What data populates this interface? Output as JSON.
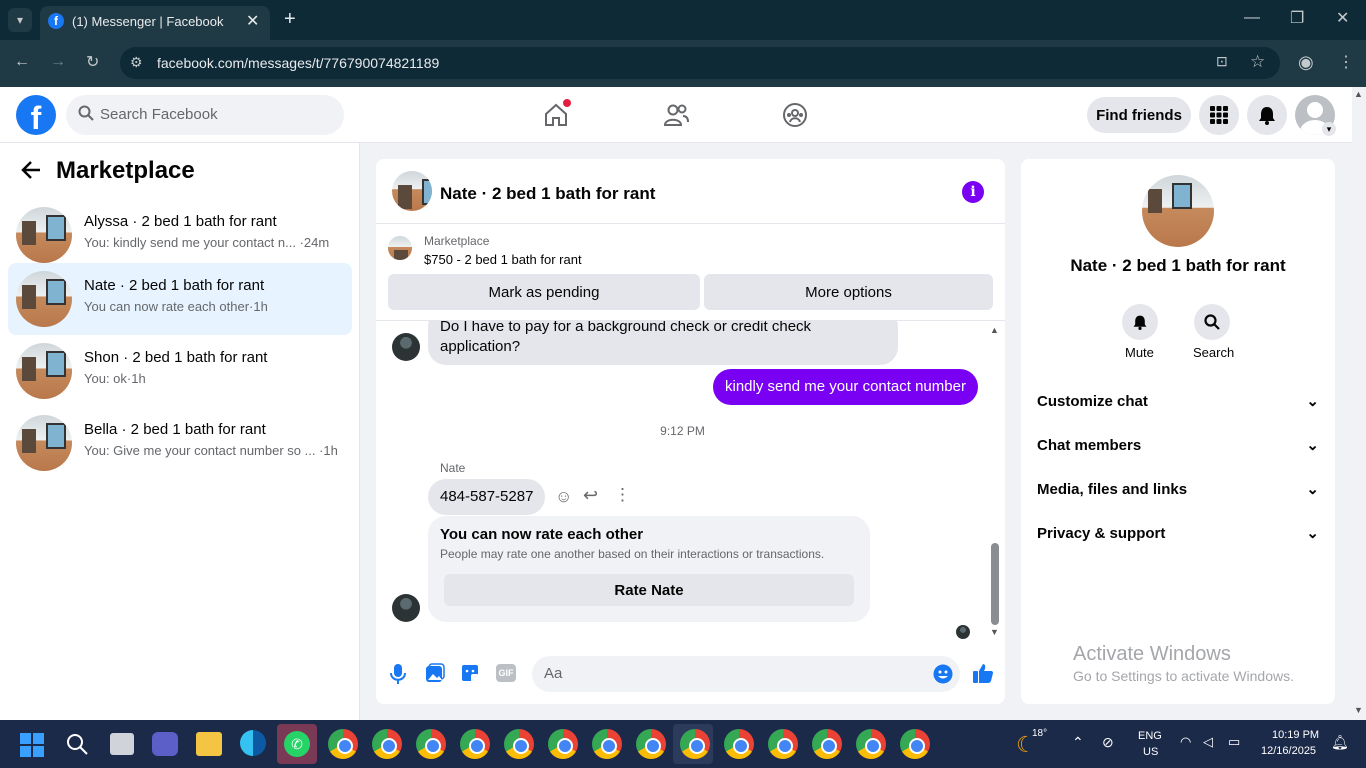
{
  "browser": {
    "tab_title": "(1) Messenger | Facebook",
    "url": "facebook.com/messages/t/776790074821189"
  },
  "header": {
    "search_placeholder": "Search Facebook",
    "find_friends": "Find friends"
  },
  "left": {
    "title": "Marketplace",
    "conversations": [
      {
        "name": "Alyssa · 2 bed 1 bath for rant",
        "preview": "You: kindly send me your contact n... ·24m",
        "selected": false
      },
      {
        "name": "Nate · 2 bed 1 bath for rant",
        "preview": "You can now rate each other·1h",
        "selected": true
      },
      {
        "name": "Shon · 2 bed 1 bath for rant",
        "preview": "You: ok·1h",
        "selected": false
      },
      {
        "name": "Bella · 2 bed 1 bath for rant",
        "preview": "You: Give me your contact number so ... ·1h",
        "selected": false
      }
    ]
  },
  "chat": {
    "title": "Nate · 2 bed 1 bath for rant",
    "marketplace_label": "Marketplace",
    "listing": "$750 - 2 bed 1 bath for rant",
    "mark_pending": "Mark as pending",
    "more_options": "More options",
    "msg_incoming_1": "Do I have to pay for a background check or credit check application?",
    "msg_outgoing_1": "kindly send me your contact number",
    "timestamp": "9:12 PM",
    "sender_name": "Nate",
    "msg_incoming_2": "484-587-5287",
    "rate_title": "You can now rate each other",
    "rate_sub": "People may rate one another based on their interactions or transactions.",
    "rate_button": "Rate Nate",
    "composer_placeholder": "Aa"
  },
  "info": {
    "name": "Nate · 2 bed 1 bath for rant",
    "mute": "Mute",
    "search": "Search",
    "rows": [
      "Customize chat",
      "Chat members",
      "Media, files and links",
      "Privacy & support"
    ]
  },
  "watermark": {
    "title": "Activate Windows",
    "sub": "Go to Settings to activate Windows."
  },
  "taskbar": {
    "temp": "18°",
    "lang1": "ENG",
    "lang2": "US",
    "time": "10:19 PM",
    "date": "12/16/2025"
  },
  "colors": {
    "accent_purple": "#7a00f4",
    "fb_blue": "#1877f2",
    "selected_bg": "#e7f3ff"
  }
}
